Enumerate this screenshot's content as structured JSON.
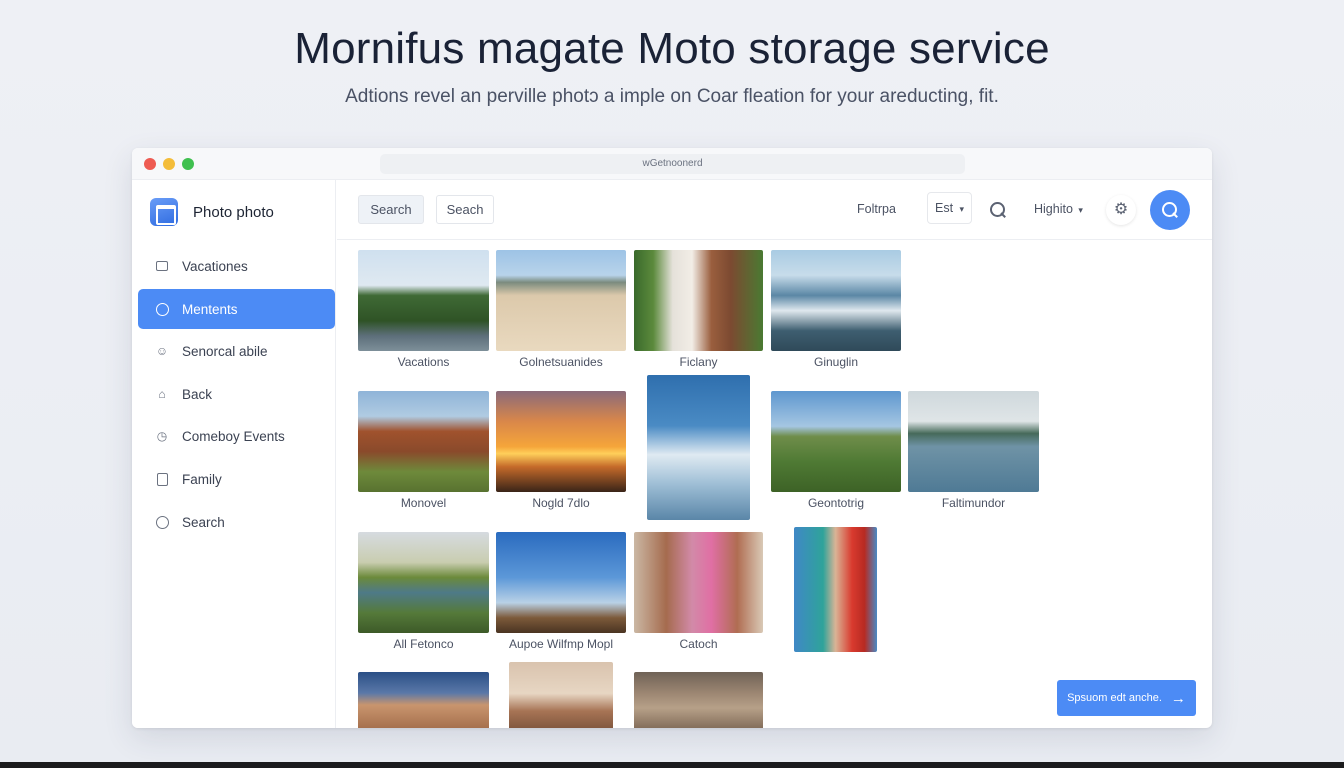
{
  "hero": {
    "title": "Mornifus magate Moto storage service",
    "subtitle": "Adtions revel an perville photↄ a imple on Coar fleation for your areducting, fit."
  },
  "window": {
    "url": "wGetnoonerd"
  },
  "sidebar": {
    "brand": "Photo photo",
    "items": [
      {
        "label": "Vacationes",
        "icon": "album-icon",
        "active": false
      },
      {
        "label": "Mentents",
        "icon": "chat-icon",
        "active": true
      },
      {
        "label": "Senorcal abile",
        "icon": "smiley-icon",
        "active": false
      },
      {
        "label": "Back",
        "icon": "home-icon",
        "active": false
      },
      {
        "label": "Comeboy Events",
        "icon": "clock-icon",
        "active": false
      },
      {
        "label": "Family",
        "icon": "frame-icon",
        "active": false
      },
      {
        "label": "Search",
        "icon": "circle-icon",
        "active": false
      }
    ]
  },
  "toolbar": {
    "search_tab": "Search",
    "search_button": "Seach",
    "folder_label": "Foltrpa",
    "sort_select": "Est",
    "view_select": "Highito"
  },
  "gallery": {
    "captions": [
      "Vacations",
      "Golnetsuanides",
      "Ficlany",
      "Ginuglin",
      "Monovel",
      "Nogld 7dlo",
      "Geontotrig",
      "Faltimundor",
      "All Fetonco",
      "Aupoe Wilfmp Mopl",
      "Catoch"
    ]
  },
  "cta": {
    "label": "Spsuom edt anche."
  },
  "colors": {
    "accent": "#4c8bf5",
    "background": "#eef0f5",
    "text": "#1d2433"
  }
}
